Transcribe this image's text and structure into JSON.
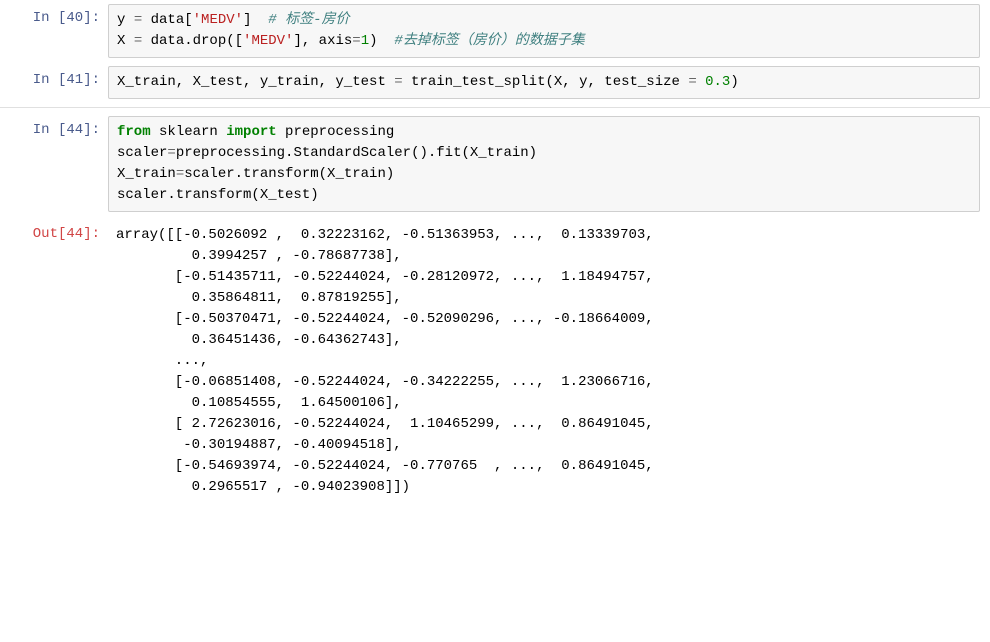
{
  "cells": [
    {
      "prompt_label": "In [40]:",
      "prompt_type": "in",
      "content_type": "input",
      "lines": [
        [
          {
            "cls": "",
            "t": "y "
          },
          {
            "cls": "tok-op",
            "t": "="
          },
          {
            "cls": "",
            "t": " data["
          },
          {
            "cls": "tok-string",
            "t": "'MEDV'"
          },
          {
            "cls": "",
            "t": "]  "
          },
          {
            "cls": "tok-comment",
            "t": "# 标签-房价"
          }
        ],
        [
          {
            "cls": "",
            "t": "X "
          },
          {
            "cls": "tok-op",
            "t": "="
          },
          {
            "cls": "",
            "t": " data.drop(["
          },
          {
            "cls": "tok-string",
            "t": "'MEDV'"
          },
          {
            "cls": "",
            "t": "], axis"
          },
          {
            "cls": "tok-op",
            "t": "="
          },
          {
            "cls": "tok-number",
            "t": "1"
          },
          {
            "cls": "",
            "t": ")  "
          },
          {
            "cls": "tok-comment",
            "t": "#去掉标签（房价）的数据子集"
          }
        ]
      ]
    },
    {
      "prompt_label": "In [41]:",
      "prompt_type": "in",
      "content_type": "input",
      "lines": [
        [
          {
            "cls": "",
            "t": "X_train, X_test, y_train, y_test "
          },
          {
            "cls": "tok-op",
            "t": "="
          },
          {
            "cls": "",
            "t": " train_test_split(X, y, test_size "
          },
          {
            "cls": "tok-op",
            "t": "="
          },
          {
            "cls": "",
            "t": " "
          },
          {
            "cls": "tok-number",
            "t": "0.3"
          },
          {
            "cls": "",
            "t": ")"
          }
        ]
      ]
    },
    {
      "divider": true
    },
    {
      "prompt_label": "In [44]:",
      "prompt_type": "in",
      "content_type": "input",
      "lines": [
        [
          {
            "cls": "tok-keyword",
            "t": "from"
          },
          {
            "cls": "",
            "t": " sklearn "
          },
          {
            "cls": "tok-keyword",
            "t": "import"
          },
          {
            "cls": "",
            "t": " preprocessing"
          }
        ],
        [
          {
            "cls": "",
            "t": "scaler"
          },
          {
            "cls": "tok-op",
            "t": "="
          },
          {
            "cls": "",
            "t": "preprocessing.StandardScaler().fit(X_train)"
          }
        ],
        [
          {
            "cls": "",
            "t": "X_train"
          },
          {
            "cls": "tok-op",
            "t": "="
          },
          {
            "cls": "",
            "t": "scaler.transform(X_train)"
          }
        ],
        [
          {
            "cls": "",
            "t": "scaler.transform(X_test)"
          }
        ]
      ]
    },
    {
      "prompt_label": "Out[44]:",
      "prompt_type": "out",
      "content_type": "output",
      "text": "array([[-0.5026092 ,  0.32223162, -0.51363953, ...,  0.13339703,\n         0.3994257 , -0.78687738],\n       [-0.51435711, -0.52244024, -0.28120972, ...,  1.18494757,\n         0.35864811,  0.87819255],\n       [-0.50370471, -0.52244024, -0.52090296, ..., -0.18664009,\n         0.36451436, -0.64362743],\n       ...,\n       [-0.06851408, -0.52244024, -0.34222255, ...,  1.23066716,\n         0.10854555,  1.64500106],\n       [ 2.72623016, -0.52244024,  1.10465299, ...,  0.86491045,\n        -0.30194887, -0.40094518],\n       [-0.54693974, -0.52244024, -0.770765  , ...,  0.86491045,\n         0.2965517 , -0.94023908]])"
    }
  ]
}
